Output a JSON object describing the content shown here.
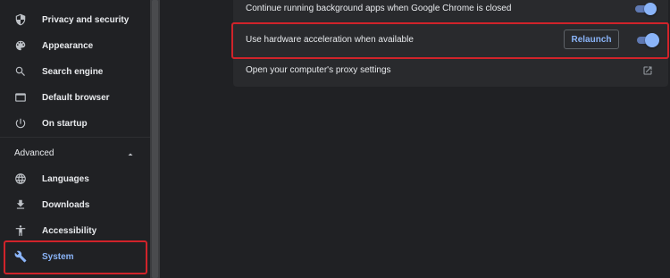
{
  "sidebar": {
    "items": [
      {
        "label": "Privacy and security",
        "icon": "shield-icon"
      },
      {
        "label": "Appearance",
        "icon": "palette-icon"
      },
      {
        "label": "Search engine",
        "icon": "search-icon"
      },
      {
        "label": "Default browser",
        "icon": "browser-window-icon"
      },
      {
        "label": "On startup",
        "icon": "power-icon"
      }
    ],
    "advanced": {
      "label": "Advanced",
      "icon": "chevron-up-icon",
      "items": [
        {
          "label": "Languages",
          "icon": "globe-icon"
        },
        {
          "label": "Downloads",
          "icon": "download-icon"
        },
        {
          "label": "Accessibility",
          "icon": "accessibility-icon"
        },
        {
          "label": "System",
          "icon": "wrench-icon",
          "active": true
        }
      ]
    }
  },
  "system": {
    "background_apps": {
      "label": "Continue running background apps when Google Chrome is closed",
      "enabled": true
    },
    "hardware_acceleration": {
      "label": "Use hardware acceleration when available",
      "enabled": true,
      "relaunch_label": "Relaunch"
    },
    "proxy": {
      "label": "Open your computer's proxy settings",
      "icon": "external-link-icon"
    }
  },
  "colors": {
    "background": "#202124",
    "card": "#292a2d",
    "accent": "#8ab4f8",
    "highlight": "#d0232a"
  }
}
